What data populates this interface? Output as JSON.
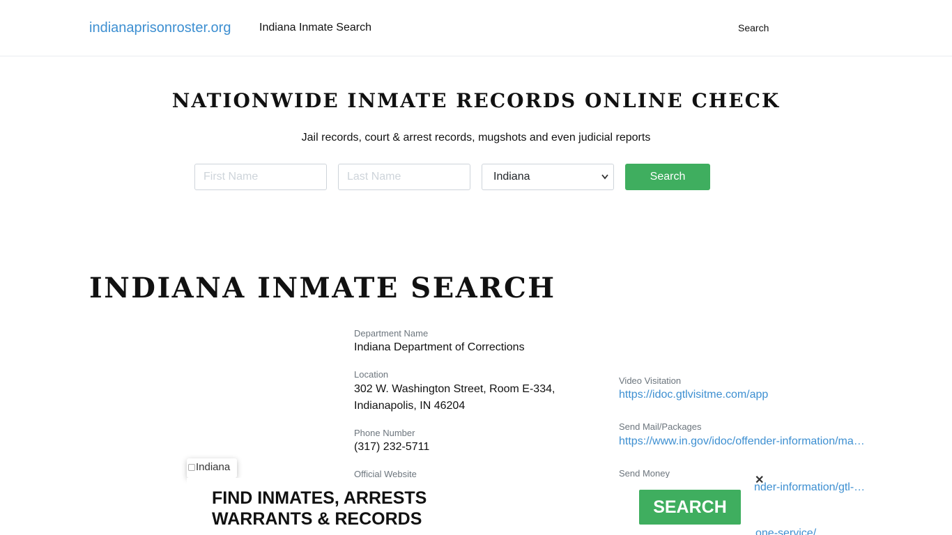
{
  "header": {
    "brand": "indianaprisonroster.org",
    "nav_link": "Indiana Inmate Search",
    "search_link": "Search"
  },
  "hero": {
    "title": "NATIONWIDE INMATE RECORDS ONLINE CHECK",
    "subtitle": "Jail records, court & arrest records, mugshots and even judicial reports",
    "first_name_placeholder": "First Name",
    "last_name_placeholder": "Last Name",
    "state_selected": "Indiana",
    "search_button": "Search"
  },
  "page": {
    "title": "INDIANA INMATE SEARCH",
    "image_alt": "Indiana"
  },
  "info_left": {
    "department_label": "Department Name",
    "department_value": "Indiana Department of Corrections",
    "location_label": "Location",
    "location_line1": "302 W. Washington Street, Room E-334,",
    "location_line2": "Indianapolis, IN 46204",
    "phone_label": "Phone Number",
    "phone_value": "(317) 232-5711",
    "website_label": "Official Website"
  },
  "info_right": {
    "video_label": "Video Visitation",
    "video_link": "https://idoc.gtlvisitme.com/app",
    "mail_label": "Send Mail/Packages",
    "mail_link": "https://www.in.gov/idoc/offender-information/ma…",
    "money_label": "Send Money",
    "money_link_partial": "nder-information/gtl-…",
    "phone_link_partial": "one-service/"
  },
  "banner": {
    "line1": "FIND INMATES, ARRESTS",
    "line2": "WARRANTS & RECORDS",
    "button": "SEARCH",
    "close": "✕"
  },
  "colors": {
    "accent_green": "#3fae5f",
    "link_blue": "#3d8fd1"
  }
}
